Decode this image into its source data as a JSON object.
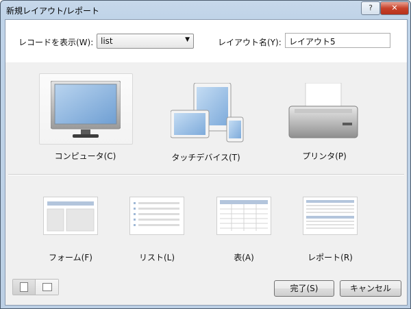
{
  "window": {
    "title": "新規レイアウト/レポート",
    "help_button": "?",
    "close_button": "✕"
  },
  "form": {
    "record_label": "レコードを表示(W):",
    "record_select": {
      "value": "list",
      "icon": "chevron-down-icon"
    },
    "layout_name_label": "レイアウト名(Y):",
    "layout_name_value": "レイアウト5"
  },
  "devices": {
    "items": [
      {
        "label": "コンピュータ(C)",
        "icon": "computer-monitor-icon",
        "selected": true
      },
      {
        "label": "タッチデバイス(T)",
        "icon": "touch-devices-icon",
        "selected": false
      },
      {
        "label": "プリンタ(P)",
        "icon": "printer-icon",
        "selected": false
      }
    ]
  },
  "layouts": {
    "items": [
      {
        "label": "フォーム(F)",
        "icon": "form-layout-icon"
      },
      {
        "label": "リスト(L)",
        "icon": "list-layout-icon"
      },
      {
        "label": "表(A)",
        "icon": "table-layout-icon"
      },
      {
        "label": "レポート(R)",
        "icon": "report-layout-icon"
      }
    ]
  },
  "footer": {
    "view_toggle": [
      "portrait-view-icon",
      "landscape-view-icon"
    ],
    "ok_button": "完了(S)",
    "cancel_button": "キャンセル"
  }
}
